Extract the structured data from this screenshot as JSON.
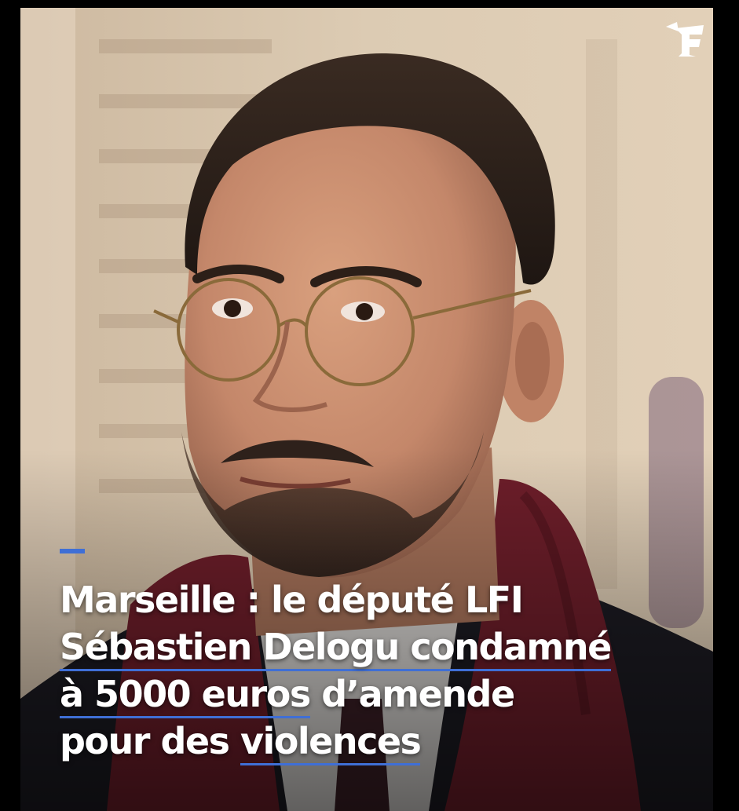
{
  "image": {
    "subject": "portrait-photo",
    "logo_icon": "le-figaro-f-logo",
    "colors": {
      "accent": "#3f6fd6",
      "scarf": "#6e1e2a",
      "background_wall": "#d9c7ae",
      "text": "#ffffff"
    }
  },
  "headline": {
    "line1": "Marseille : le député LFI",
    "line2_underlined": "Sébastien Delogu condamné",
    "line3_underlined": "à 5000 euros",
    "line3_rest": " d’amende",
    "line4_plain": "pour des ",
    "line4_underlined": "violences"
  }
}
